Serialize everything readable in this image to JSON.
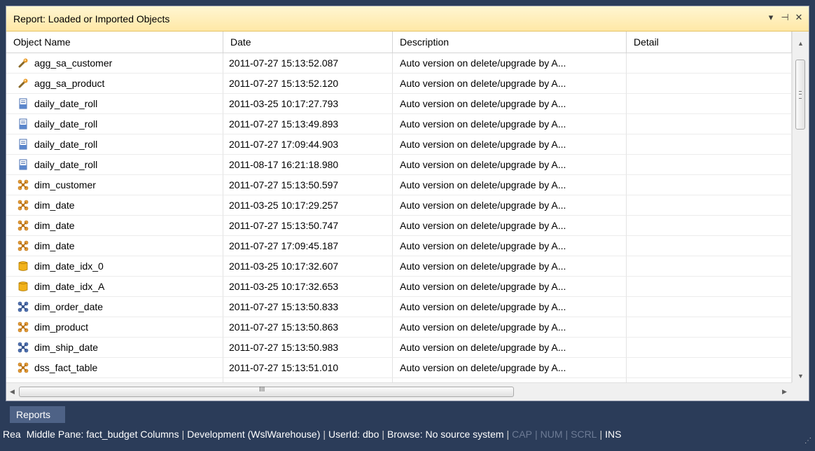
{
  "window": {
    "title": "Report: Loaded or Imported Objects",
    "buttons": [
      "▾",
      "⊣",
      "✕"
    ]
  },
  "columns": [
    "Object Name",
    "Date",
    "Description",
    "Detail"
  ],
  "rows": [
    {
      "icon": "aggregate-icon",
      "name": "agg_sa_customer",
      "date": "2011-07-27 15:13:52.087",
      "desc": "Auto version on delete/upgrade by A...",
      "detail": ""
    },
    {
      "icon": "aggregate-icon",
      "name": "agg_sa_product",
      "date": "2011-07-27 15:13:52.120",
      "desc": "Auto version on delete/upgrade by A...",
      "detail": ""
    },
    {
      "icon": "procedure-icon",
      "name": "daily_date_roll",
      "date": "2011-03-25 10:17:27.793",
      "desc": "Auto version on delete/upgrade by A...",
      "detail": ""
    },
    {
      "icon": "procedure-icon",
      "name": "daily_date_roll",
      "date": "2011-07-27 15:13:49.893",
      "desc": "Auto version on delete/upgrade by A...",
      "detail": ""
    },
    {
      "icon": "procedure-icon",
      "name": "daily_date_roll",
      "date": "2011-07-27 17:09:44.903",
      "desc": "Auto version on delete/upgrade by A...",
      "detail": ""
    },
    {
      "icon": "procedure-icon",
      "name": "daily_date_roll",
      "date": "2011-08-17 16:21:18.980",
      "desc": "Auto version on delete/upgrade by A...",
      "detail": ""
    },
    {
      "icon": "dimension-icon",
      "name": "dim_customer",
      "date": "2011-07-27 15:13:50.597",
      "desc": "Auto version on delete/upgrade by A...",
      "detail": ""
    },
    {
      "icon": "dimension-icon",
      "name": "dim_date",
      "date": "2011-03-25 10:17:29.257",
      "desc": "Auto version on delete/upgrade by A...",
      "detail": ""
    },
    {
      "icon": "dimension-icon",
      "name": "dim_date",
      "date": "2011-07-27 15:13:50.747",
      "desc": "Auto version on delete/upgrade by A...",
      "detail": ""
    },
    {
      "icon": "dimension-icon",
      "name": "dim_date",
      "date": "2011-07-27 17:09:45.187",
      "desc": "Auto version on delete/upgrade by A...",
      "detail": ""
    },
    {
      "icon": "index-icon",
      "name": "dim_date_idx_0",
      "date": "2011-03-25 10:17:32.607",
      "desc": "Auto version on delete/upgrade by A...",
      "detail": ""
    },
    {
      "icon": "index-icon",
      "name": "dim_date_idx_A",
      "date": "2011-03-25 10:17:32.653",
      "desc": "Auto version on delete/upgrade by A...",
      "detail": ""
    },
    {
      "icon": "view-icon",
      "name": "dim_order_date",
      "date": "2011-07-27 15:13:50.833",
      "desc": "Auto version on delete/upgrade by A...",
      "detail": ""
    },
    {
      "icon": "dimension-icon",
      "name": "dim_product",
      "date": "2011-07-27 15:13:50.863",
      "desc": "Auto version on delete/upgrade by A...",
      "detail": ""
    },
    {
      "icon": "view-icon",
      "name": "dim_ship_date",
      "date": "2011-07-27 15:13:50.983",
      "desc": "Auto version on delete/upgrade by A...",
      "detail": ""
    },
    {
      "icon": "dimension-icon",
      "name": "dss_fact_table",
      "date": "2011-07-27 15:13:51.010",
      "desc": "Auto version on delete/upgrade by A...",
      "detail": ""
    }
  ],
  "scrollbar": {
    "horizontal_grip": "III"
  },
  "tab": {
    "label": "Reports"
  },
  "status": {
    "mode": "Rea",
    "pane": "Middle Pane: fact_budget Columns",
    "environment": "Development (WslWarehouse)",
    "user": "UserId: dbo",
    "browse": "Browse: No source system",
    "cap": "CAP",
    "num": "NUM",
    "scrl": "SCRL",
    "ins": "INS"
  },
  "colors": {
    "titlebar": "#ffe8a6",
    "frame": "#2b3c59",
    "tab": "#4e6286"
  }
}
